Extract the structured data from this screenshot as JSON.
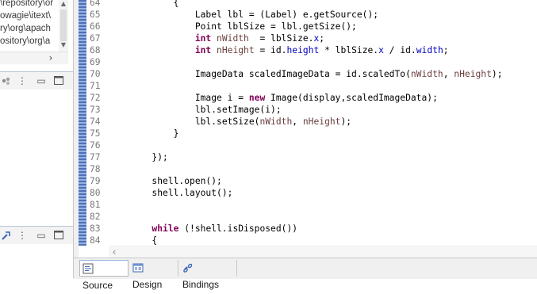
{
  "left_panel": {
    "tree_paths": [
      "\\repository\\or",
      "owagie\\itext\\",
      "ry\\org\\apach",
      "ository\\org\\a"
    ]
  },
  "editor": {
    "lines": [
      {
        "num": "64",
        "text": "            {"
      },
      {
        "num": "65",
        "text": "                Label lbl = (Label) e.getSource();"
      },
      {
        "num": "66",
        "text": "                Point lblSize = lbl.getSize();"
      },
      {
        "num": "67",
        "text": "                int nWidth  = lblSize.x;"
      },
      {
        "num": "68",
        "text": "                int nHeight = id.height * lblSize.x / id.width;"
      },
      {
        "num": "69",
        "text": ""
      },
      {
        "num": "70",
        "text": "                ImageData scaledImageData = id.scaledTo(nWidth, nHeight);"
      },
      {
        "num": "71",
        "text": ""
      },
      {
        "num": "72",
        "text": "                Image i = new Image(display,scaledImageData);"
      },
      {
        "num": "73",
        "text": "                lbl.setImage(i);"
      },
      {
        "num": "74",
        "text": "                lbl.setSize(nWidth, nHeight);"
      },
      {
        "num": "75",
        "text": "            }"
      },
      {
        "num": "76",
        "text": ""
      },
      {
        "num": "77",
        "text": "        });"
      },
      {
        "num": "78",
        "text": ""
      },
      {
        "num": "79",
        "text": "        shell.open();"
      },
      {
        "num": "80",
        "text": "        shell.layout();"
      },
      {
        "num": "81",
        "text": ""
      },
      {
        "num": "82",
        "text": ""
      },
      {
        "num": "83",
        "text": "        while (!shell.isDisposed())"
      },
      {
        "num": "84",
        "text": "        {"
      }
    ]
  },
  "tabs": [
    {
      "label": "Source",
      "icon": "source-icon",
      "active": true
    },
    {
      "label": "Design",
      "icon": "design-icon",
      "active": false
    },
    {
      "label": "Bindings",
      "icon": "bindings-icon",
      "active": false
    }
  ],
  "colors": {
    "keyword": "#7f0055",
    "field": "#0000c0",
    "annotation_bar": "#4e72b8"
  }
}
